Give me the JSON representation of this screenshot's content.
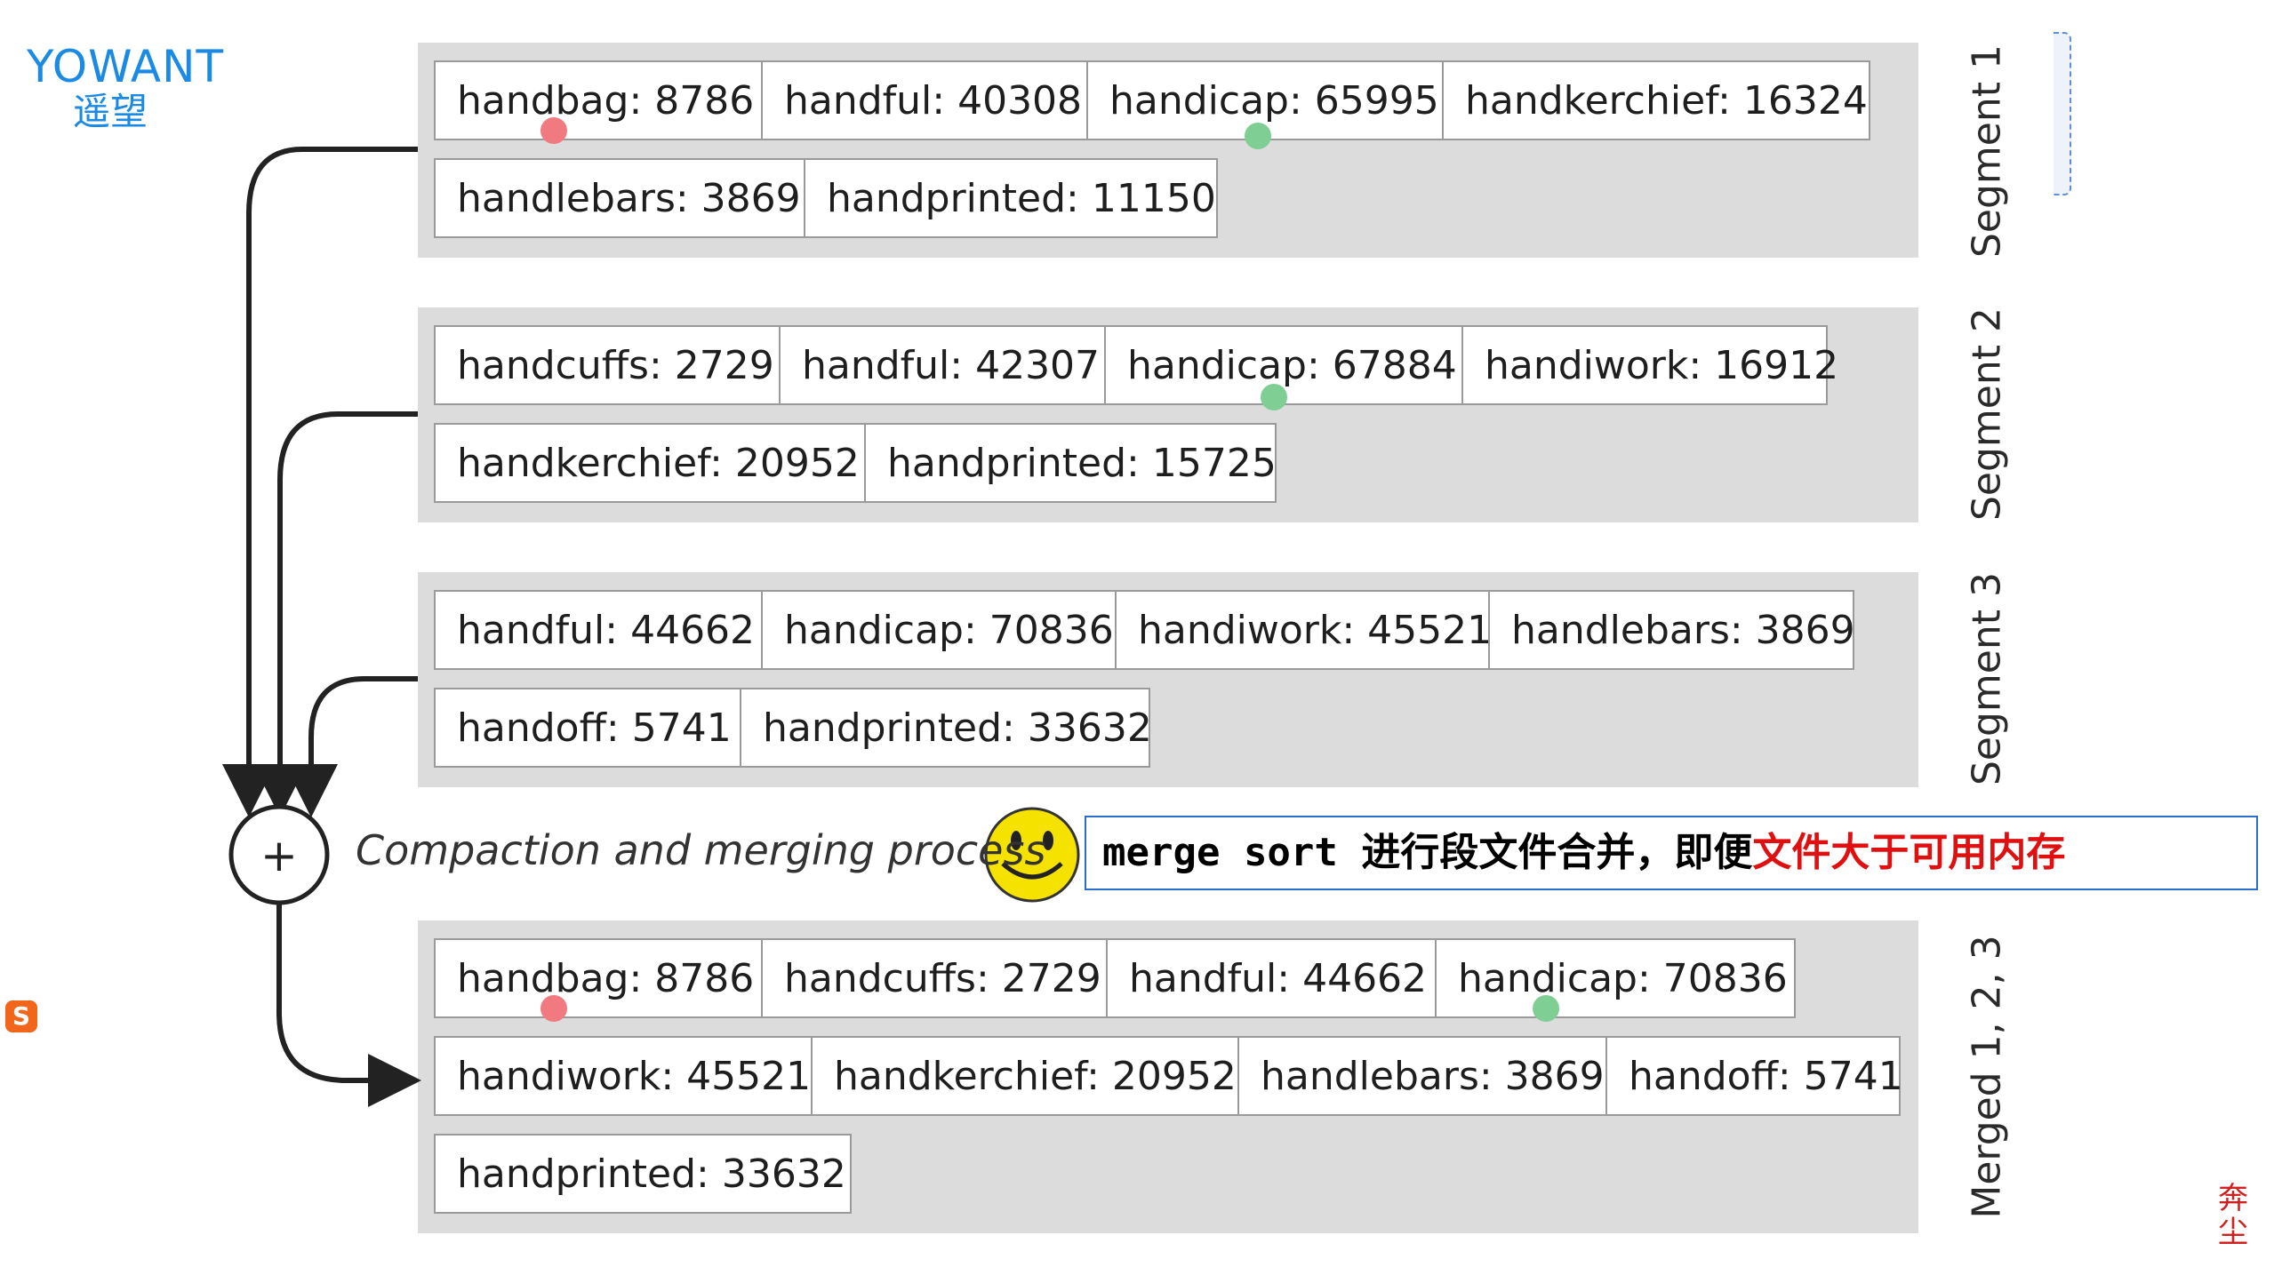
{
  "logo": {
    "en": "YOWANT",
    "cn": "遥望"
  },
  "segments": [
    {
      "label": "Segment 1",
      "rows": [
        [
          "handbag: 8786",
          "handful: 40308",
          "handicap: 65995",
          "handkerchief: 16324"
        ],
        [
          "handlebars: 3869",
          "handprinted: 11150"
        ]
      ]
    },
    {
      "label": "Segment 2",
      "rows": [
        [
          "handcuffs: 2729",
          "handful: 42307",
          "handicap: 67884",
          "handiwork: 16912"
        ],
        [
          "handkerchief: 20952",
          "handprinted: 15725"
        ]
      ]
    },
    {
      "label": "Segment 3",
      "rows": [
        [
          "handful: 44662",
          "handicap: 70836",
          "handiwork: 45521",
          "handlebars: 3869"
        ],
        [
          "handoff: 5741",
          "handprinted: 33632"
        ]
      ]
    }
  ],
  "merged": {
    "label": "Merged 1, 2, 3",
    "rows": [
      [
        "handbag: 8786",
        "handcuffs: 2729",
        "handful: 44662",
        "handicap: 70836"
      ],
      [
        "handiwork: 45521",
        "handkerchief: 20952",
        "handlebars: 3869",
        "handoff: 5741"
      ],
      [
        "handprinted: 33632"
      ]
    ]
  },
  "process": {
    "symbol": "+",
    "label": "Compaction and merging process"
  },
  "note": {
    "part1": "merge sort 进行段文件合并，即便",
    "part2": "文件大于可用内存"
  },
  "brand_icon": "S",
  "stamp": "奔 尘",
  "colors": {
    "segment_bg": "#dcdcdc",
    "note_border": "#2a6fc9",
    "note_red": "#e01010",
    "logo_blue": "#1a8ae5"
  }
}
